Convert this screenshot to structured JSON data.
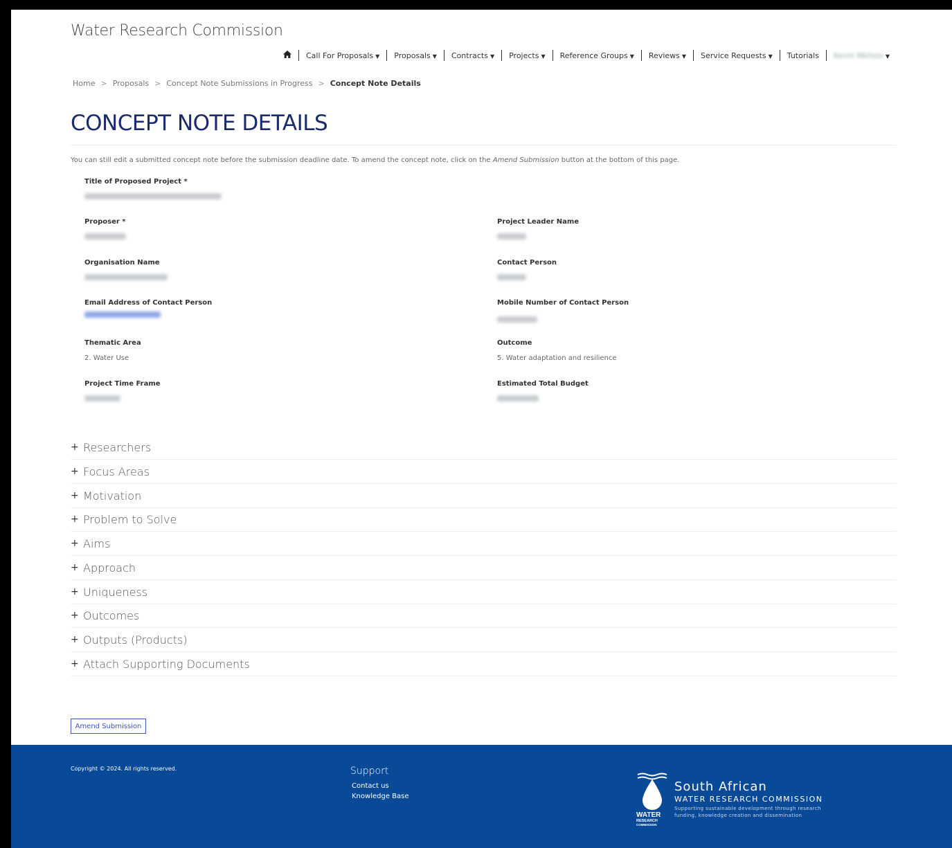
{
  "brand": "Water Research Commission",
  "nav": {
    "items": [
      {
        "label": "Call For Proposals",
        "dropdown": true
      },
      {
        "label": "Proposals",
        "dropdown": true
      },
      {
        "label": "Contracts",
        "dropdown": true
      },
      {
        "label": "Projects",
        "dropdown": true
      },
      {
        "label": "Reference Groups",
        "dropdown": true
      },
      {
        "label": "Reviews",
        "dropdown": true
      },
      {
        "label": "Service Requests",
        "dropdown": true
      },
      {
        "label": "Tutorials",
        "dropdown": false
      }
    ],
    "user_menu": "Kevin Mkhize"
  },
  "breadcrumb": [
    "Home",
    "Proposals",
    "Concept Note Submissions in Progress",
    "Concept Note Details"
  ],
  "page_title": "CONCEPT NOTE DETAILS",
  "intro": {
    "before": "You can still edit a submitted concept note before the submission deadline date. To amend the concept note, click on the ",
    "emphasis": "Amend Submission",
    "after": " button at the bottom of this page."
  },
  "fields": {
    "title_label": "Title of Proposed Project *",
    "proposer_label": "Proposer *",
    "project_leader_label": "Project Leader Name",
    "organisation_label": "Organisation Name",
    "contact_person_label": "Contact Person",
    "email_label": "Email Address of Contact Person",
    "mobile_label": "Mobile Number of Contact Person",
    "thematic_label": "Thematic Area",
    "thematic_value": "2. Water Use",
    "outcome_label": "Outcome",
    "outcome_value": "5. Water adaptation and resilience",
    "timeframe_label": "Project Time Frame",
    "budget_label": "Estimated Total Budget"
  },
  "sections": [
    "Researchers",
    "Focus Areas",
    "Motivation",
    "Problem to Solve",
    "Aims",
    "Approach",
    "Uniqueness",
    "Outcomes",
    "Outputs (Products)",
    "Attach Supporting Documents"
  ],
  "amend_button": "Amend Submission",
  "footer": {
    "copyright": "Copyright © 2024. All rights reserved.",
    "support_heading": "Support",
    "support_links": [
      "Contact us",
      "Knowledge Base"
    ],
    "logo_line1": "South African",
    "logo_line2": "WATER RESEARCH COMMISSION",
    "logo_line3": "Supporting sustainable development through research",
    "logo_line4": "funding, knowledge creation and dissemination",
    "logo_word1": "WATER",
    "logo_word2": "RESEARCH",
    "logo_word3": "COMMISSION"
  },
  "colors": {
    "title": "#1a2a6c",
    "accent": "#3c55b8",
    "footer_bg": "#084a97"
  }
}
